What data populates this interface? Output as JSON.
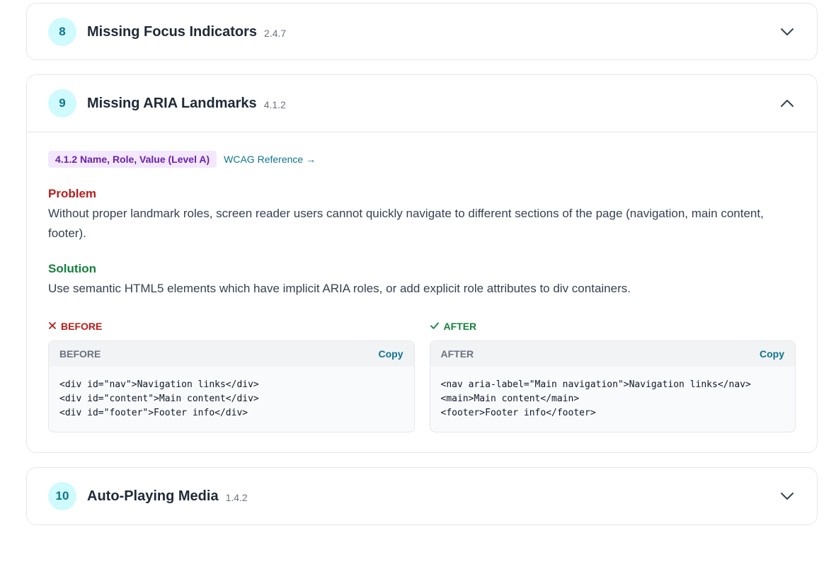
{
  "issues": [
    {
      "number": "8",
      "title": "Missing Focus Indicators",
      "criterion": "2.4.7",
      "expanded": false
    },
    {
      "number": "9",
      "title": "Missing ARIA Landmarks",
      "criterion": "4.1.2",
      "expanded": true,
      "badge": "4.1.2 Name, Role, Value (Level A)",
      "reference_link": "WCAG Reference →",
      "problem_title": "Problem",
      "problem_text": "Without proper landmark roles, screen reader users cannot quickly navigate to different sections of the page (navigation, main content, footer).",
      "solution_title": "Solution",
      "solution_text": "Use semantic HTML5 elements which have implicit ARIA roles, or add explicit role attributes to div containers.",
      "before": {
        "label": "BEFORE",
        "icon": "x-icon",
        "box_title": "BEFORE",
        "copy_label": "Copy",
        "code": "<div id=\"nav\">Navigation links</div>\n<div id=\"content\">Main content</div>\n<div id=\"footer\">Footer info</div>"
      },
      "after": {
        "label": "AFTER",
        "icon": "check-icon",
        "box_title": "AFTER",
        "copy_label": "Copy",
        "code": "<nav aria-label=\"Main navigation\">Navigation links</nav>\n<main>Main content</main>\n<footer>Footer info</footer>"
      }
    },
    {
      "number": "10",
      "title": "Auto-Playing Media",
      "criterion": "1.4.2",
      "expanded": false
    }
  ],
  "colors": {
    "accent": "#0e7490",
    "badge_bg": "#f3e8ff",
    "problem": "#b91c1c",
    "solution": "#15803d"
  }
}
